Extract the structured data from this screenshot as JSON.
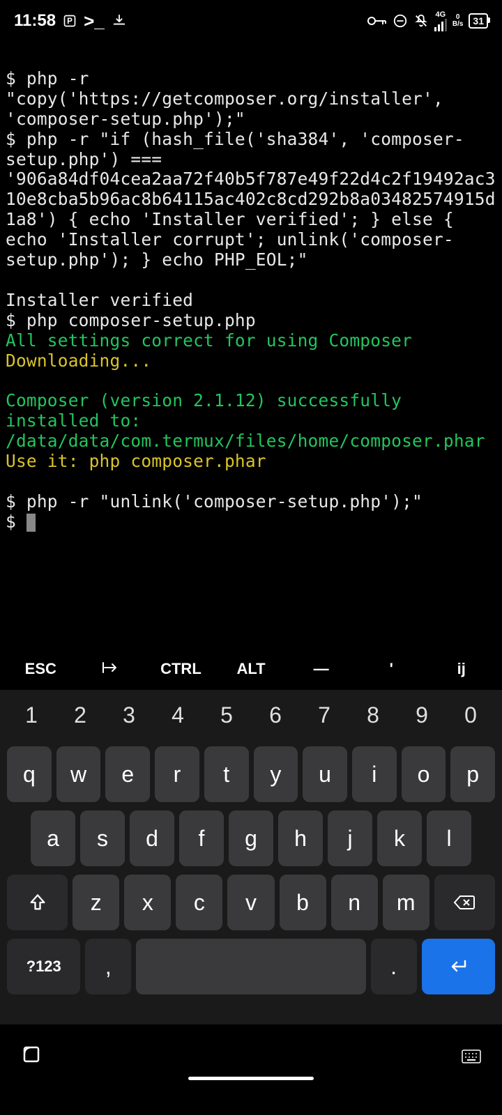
{
  "status": {
    "time": "11:58",
    "netlabel": "4G",
    "netspeed_value": "0",
    "netspeed_unit": "B/s",
    "battery": "31"
  },
  "terminal": {
    "line1": "$ php -r \"copy('https://getcomposer.org/installer', 'composer-setup.php');\"",
    "line2": "$ php -r \"if (hash_file('sha384', 'composer-setup.php') === '906a84df04cea2aa72f40b5f787e49f22d4c2f19492ac310e8cba5b96ac8b64115ac402c8cd292b8a03482574915d1a8') { echo 'Installer verified'; } else { echo 'Installer corrupt'; unlink('composer-setup.php'); } echo PHP_EOL;\"",
    "blank1": "",
    "line3": "Installer verified",
    "line4": "$ php composer-setup.php",
    "line5_green": "All settings correct for using Composer",
    "line6_yellow": "Downloading...",
    "blank2": "",
    "line7_green": "Composer (version 2.1.12) successfully installed to: /data/data/com.termux/files/home/composer.phar",
    "line8_yellow": "Use it: php composer.phar",
    "blank3": "",
    "line9": "$ php -r \"unlink('composer-setup.php');\"",
    "prompt": "$ "
  },
  "extra": {
    "esc": "ESC",
    "tab": "⇥",
    "ctrl": "CTRL",
    "alt": "ALT",
    "dash": "—",
    "apos": "'",
    "ij": "ij"
  },
  "kb": {
    "nums": [
      "1",
      "2",
      "3",
      "4",
      "5",
      "6",
      "7",
      "8",
      "9",
      "0"
    ],
    "r1": [
      "q",
      "w",
      "e",
      "r",
      "t",
      "y",
      "u",
      "i",
      "o",
      "p"
    ],
    "r2": [
      "a",
      "s",
      "d",
      "f",
      "g",
      "h",
      "j",
      "k",
      "l"
    ],
    "r3": [
      "z",
      "x",
      "c",
      "v",
      "b",
      "n",
      "m"
    ],
    "sym": "?123",
    "comma": ",",
    "period": "."
  }
}
